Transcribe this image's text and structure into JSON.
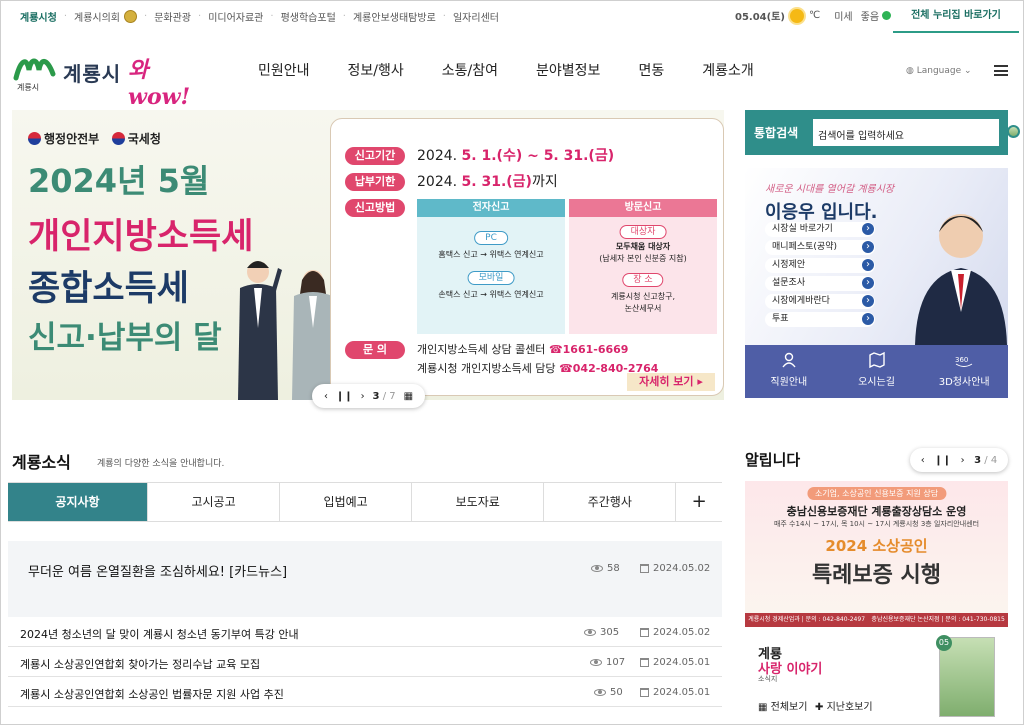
{
  "util": {
    "links": [
      "계룡시청",
      "계룡시의회",
      "문화관광",
      "미디어자료관",
      "평생학습포털",
      "계룡안보생태탐방로",
      "일자리센터"
    ],
    "date": "05.04(토)",
    "temp_unit": "℃",
    "dust_label": "미세",
    "dust_status": "좋음",
    "allnuri": "전체 누리집 바로가기"
  },
  "header": {
    "logo_name": "계룡시",
    "logo_wow": "와wow!",
    "logo_sub": "계룡시",
    "nav": [
      "민원안내",
      "정보/행사",
      "소통/참여",
      "분야별정보",
      "면동",
      "계룡소개"
    ],
    "language": "Language"
  },
  "banner": {
    "ministries": [
      "행정안전부",
      "국세청"
    ],
    "title1": "2024년 5월",
    "title2": "개인지방소득세",
    "title3": "종합소득세",
    "title4": "신고·납부의 달",
    "period_label": "신고기간",
    "period_pre": "2024.",
    "period_value": "5. 1.(수) ~ 5. 31.(금)",
    "due_label": "납부기한",
    "due_pre": "2024.",
    "due_value": "5. 31.(금)",
    "due_suffix": "까지",
    "method_label": "신고방법",
    "col1_title": "전자신고",
    "col1_tag1": "PC",
    "col1_line1": "홈택스 신고 → 위택스 연계신고",
    "col1_tag2": "모바일",
    "col1_line2": "손택스 신고 → 위택스 연계신고",
    "col2_title": "방문신고",
    "col2_tag1": "대상자",
    "col2_line1a": "모두채움 대상자",
    "col2_line1b": "(납세자 본인 신분증 지참)",
    "col2_tag2": "장 소",
    "col2_line2a": "계룡시청 신고창구,",
    "col2_line2b": "논산세무서",
    "contact_label": "문 의",
    "contact1_pre": "개인지방소득세 상담 콜센터",
    "contact1_num": "☎1661-6669",
    "contact2_pre": "계룡시청 개인지방소득세 담당",
    "contact2_num": "☎042-840-2764",
    "more": "자세히 보기 ▸",
    "page_current": "3",
    "page_total": "/ 7"
  },
  "search": {
    "label": "통합검색",
    "placeholder": "검색어를 입력하세요"
  },
  "mayor": {
    "slogan": "새로운 시대를 열어갈 계룡시장",
    "name": "이응우 입니다.",
    "links": [
      "시장실 바로가기",
      "매니페스토(공약)",
      "시정제안",
      "설문조사",
      "시장에게바란다",
      "투표"
    ],
    "quick": [
      "직원안내",
      "오시는길",
      "3D청사안내"
    ]
  },
  "news": {
    "title": "계룡소식",
    "desc": "계룡의 다양한 소식을 안내합니다.",
    "tabs": [
      "공지사항",
      "고시공고",
      "입법예고",
      "보도자료",
      "주간행사"
    ],
    "plus": "+",
    "items": [
      {
        "title": "무더운 여름 온열질환을 조심하세요! [카드뉴스]",
        "views": "58",
        "date": "2024.05.02"
      },
      {
        "title": "2024년 청소년의 달 맞이 계룡시 청소년 동기부여 특강 안내",
        "views": "305",
        "date": "2024.05.02"
      },
      {
        "title": "계룡시 소상공인연합회 찾아가는 정리수납 교육 모집",
        "views": "107",
        "date": "2024.05.01"
      },
      {
        "title": "계룡시 소상공인연합회 소상공인 법률자문 지원 사업 추진",
        "views": "50",
        "date": "2024.05.01"
      }
    ]
  },
  "notice": {
    "title": "알립니다",
    "page_current": "3",
    "page_total": "/ 4",
    "poster_pill": "소기업, 소상공인 신용보증 지원 상담",
    "poster_h1": "충남신용보증재단 계룡출장상담소 운영",
    "poster_h2": "매주 수14시 ~ 17시, 목 10시 ~ 17시 계룡시청 3층 일자리안내센터",
    "poster_year": "2024 소상공인",
    "poster_big": "특례보증 시행",
    "poster_foot1": "계룡시청 경제산업과 | 문의 : 042-840-2497",
    "poster_foot2": "충남신용보증재단 논산지점 | 문의 : 041-730-0815"
  },
  "story": {
    "t1": "계룡",
    "t2": "사랑 이야기",
    "t3": "소식지",
    "all": "전체보기",
    "past": "지난호보기",
    "issue": "05"
  }
}
